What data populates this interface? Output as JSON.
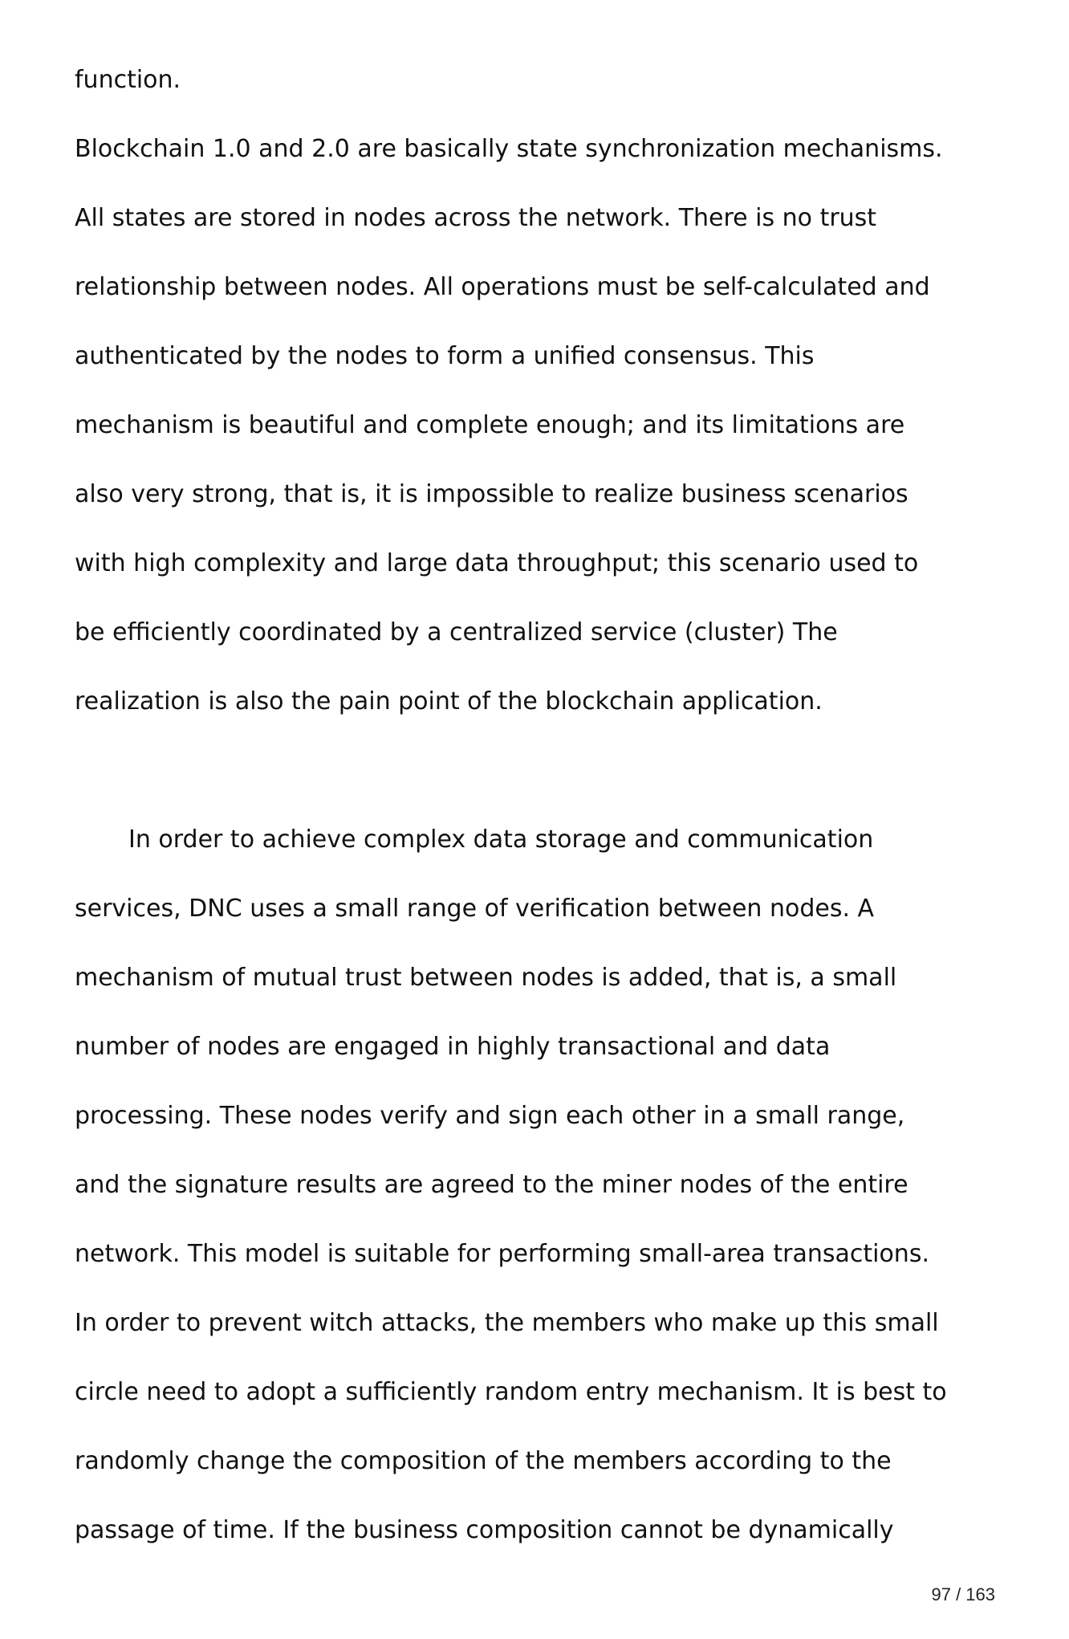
{
  "document": {
    "para1_lines": [
      "function.",
      "Blockchain 1.0 and 2.0 are basically state synchronization mechanisms.",
      "All states are stored in nodes across the network. There is no trust",
      "relationship between nodes. All operations must be self-calculated and",
      "authenticated by the nodes to form a unified consensus. This",
      "mechanism is beautiful and complete enough; and its limitations are",
      "also very strong, that is, it is impossible to realize business scenarios",
      "with high complexity and large data throughput; this scenario used to",
      "be efficiently coordinated by a centralized service (cluster) The",
      "realization is also the pain point of the blockchain application."
    ],
    "para2_lines": [
      "In order to achieve complex data storage and communication",
      "services, DNC uses a small range of verification between nodes. A",
      "mechanism of mutual trust between nodes is added, that is, a small",
      "number of nodes are engaged in highly transactional and data",
      "processing. These nodes verify and sign each other in a small range,",
      "and the signature results are agreed to the miner nodes of the entire",
      "network. This model is suitable for performing small-area transactions.",
      "In order to prevent witch attacks, the members who make up this small",
      "circle need to adopt a sufficiently random entry mechanism. It is best to",
      "randomly change the composition of the members according to the",
      "passage of time. If the business composition cannot be dynamically"
    ],
    "page_number": "97 / 163"
  }
}
